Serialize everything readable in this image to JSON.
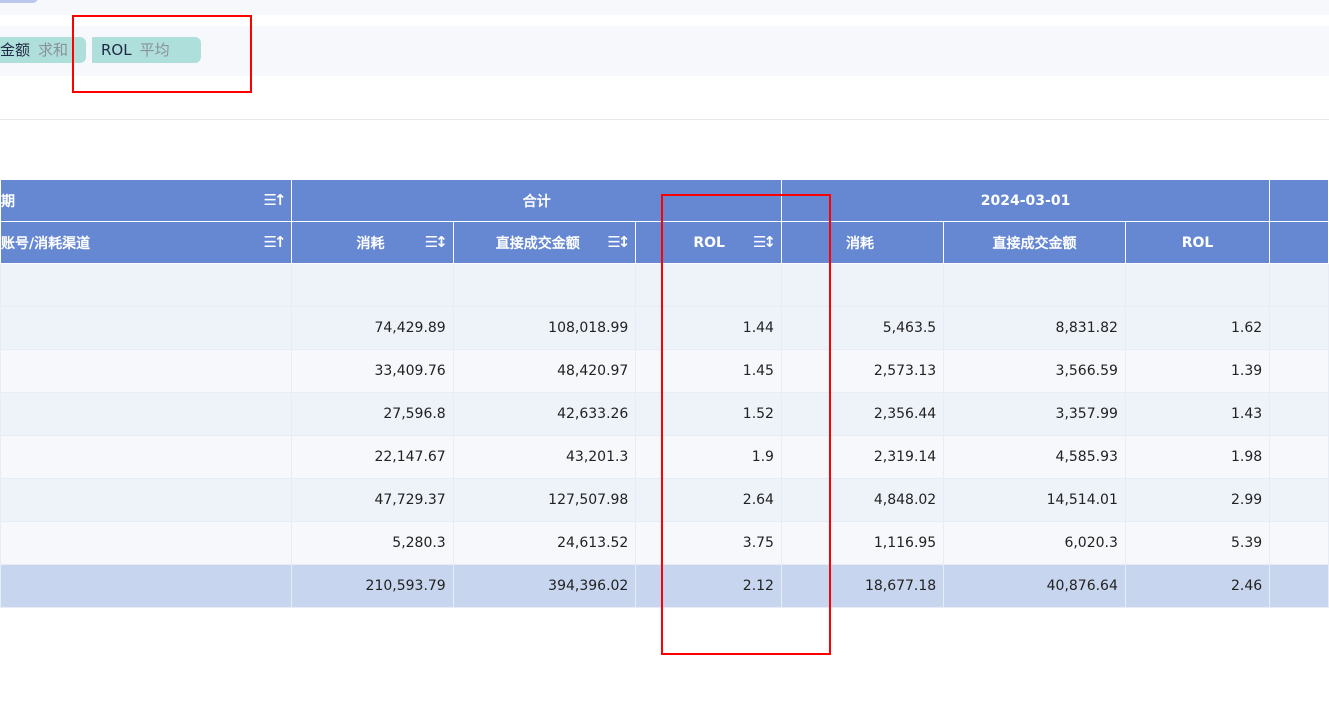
{
  "chips": [
    {
      "field": "金额",
      "agg": "求和"
    },
    {
      "field": "ROL",
      "agg": "平均"
    }
  ],
  "header": {
    "row_dim": "期",
    "col_dim": "账号/消耗渠道",
    "total": "合计",
    "date": "2024-03-01",
    "metrics": [
      "消耗",
      "直接成交金额",
      "ROL"
    ]
  },
  "rows": [
    [
      "",
      "",
      "",
      "",
      "",
      ""
    ],
    [
      "74,429.89",
      "108,018.99",
      "1.44",
      "5,463.5",
      "8,831.82",
      "1.62"
    ],
    [
      "33,409.76",
      "48,420.97",
      "1.45",
      "2,573.13",
      "3,566.59",
      "1.39"
    ],
    [
      "27,596.8",
      "42,633.26",
      "1.52",
      "2,356.44",
      "3,357.99",
      "1.43"
    ],
    [
      "22,147.67",
      "43,201.3",
      "1.9",
      "2,319.14",
      "4,585.93",
      "1.98"
    ],
    [
      "47,729.37",
      "127,507.98",
      "2.64",
      "4,848.02",
      "14,514.01",
      "2.99"
    ],
    [
      "5,280.3",
      "24,613.52",
      "3.75",
      "1,116.95",
      "6,020.3",
      "5.39"
    ]
  ],
  "total_row": [
    "210,593.79",
    "394,396.02",
    "2.12",
    "18,677.18",
    "40,876.64",
    "2.46"
  ],
  "colors": {
    "header": "#6688d2",
    "chip": "#aedfdb",
    "highlight": "#ff0000"
  }
}
